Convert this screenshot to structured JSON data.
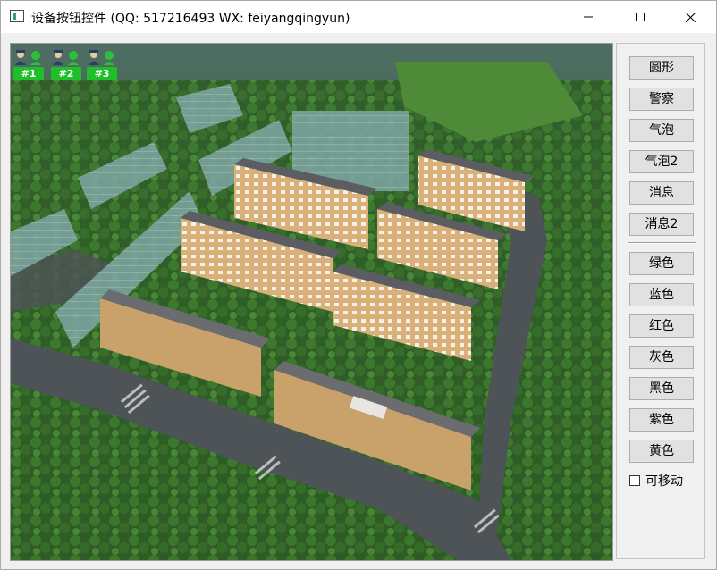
{
  "window": {
    "title": "设备按钮控件 (QQ: 517216493 WX: feiyangqingyun)"
  },
  "badges": [
    {
      "label": "#1",
      "color": "#1fbf2a"
    },
    {
      "label": "#2",
      "color": "#1fbf2a"
    },
    {
      "label": "#3",
      "color": "#1fbf2a"
    }
  ],
  "panel": {
    "style_buttons": [
      "圆形",
      "警察",
      "气泡",
      "气泡2",
      "消息",
      "消息2"
    ],
    "color_buttons": [
      "绿色",
      "蓝色",
      "红色",
      "灰色",
      "黑色",
      "紫色",
      "黄色"
    ],
    "movable_label": "可移动",
    "movable_checked": false
  },
  "icons": {
    "window_icon": "app-window-icon",
    "minimize": "minimize-icon",
    "maximize": "maximize-icon",
    "close": "close-icon",
    "badge_person": "police-officer-icon",
    "badge_device": "device-dot-icon"
  }
}
